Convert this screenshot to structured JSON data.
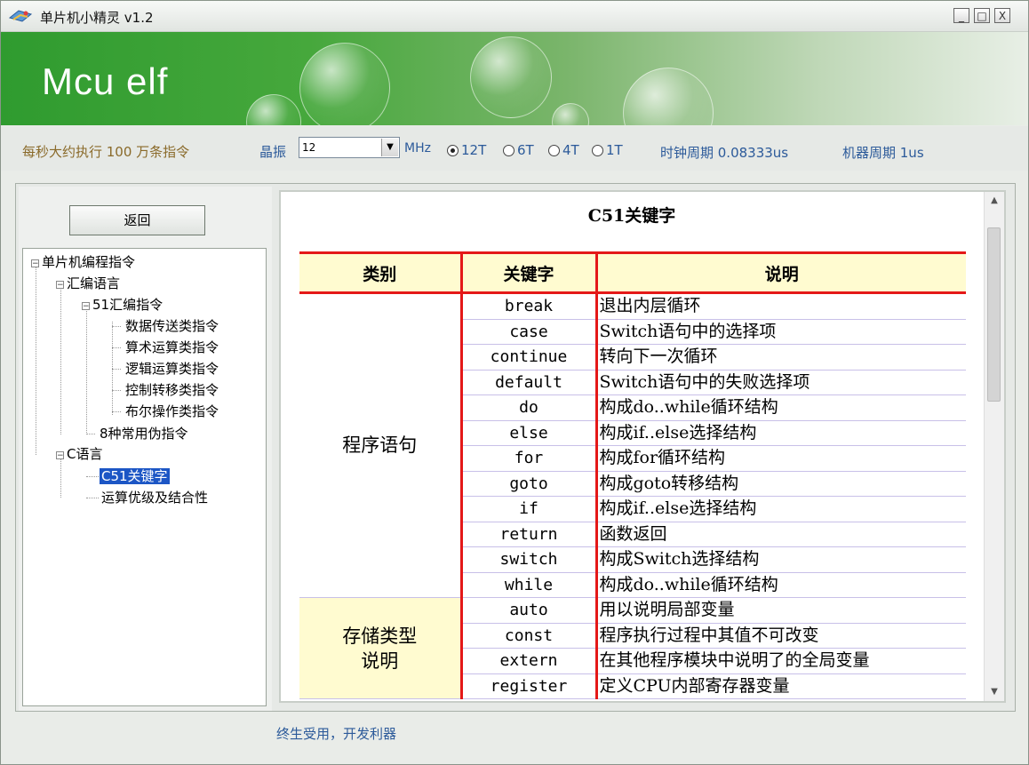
{
  "window": {
    "title": "单片机小精灵 v1.2",
    "controls": [
      "_",
      "□",
      "X"
    ]
  },
  "banner": {
    "logo": "Mcu elf"
  },
  "status": {
    "rate_text": "每秒大约执行 100 万条指令",
    "oscillator_label": "晶振",
    "oscillator_value": "12",
    "mhz_label": "MHz",
    "radios": [
      {
        "label": "12T",
        "selected": true
      },
      {
        "label": "6T",
        "selected": false
      },
      {
        "label": "4T",
        "selected": false
      },
      {
        "label": "1T",
        "selected": false
      }
    ],
    "clock_period": "时钟周期 0.08333us",
    "machine_period": "机器周期 1us"
  },
  "sidebar": {
    "back_label": "返回",
    "tree": {
      "root": "单片机编程指令",
      "asm": "汇编语言",
      "asm51": "51汇编指令",
      "asm51_items": [
        "数据传送类指令",
        "算术运算类指令",
        "逻辑运算类指令",
        "控制转移类指令",
        "布尔操作类指令"
      ],
      "pseudo": "8种常用伪指令",
      "clang": "C语言",
      "c51": "C51关键字",
      "priority": "运算优级及结合性"
    }
  },
  "content": {
    "title": "C51关键字",
    "headers": {
      "category": "类别",
      "keyword": "关键字",
      "description": "说明"
    },
    "groups": [
      {
        "category": "程序语句",
        "rows": [
          {
            "kw": "break",
            "desc": "退出内层循环"
          },
          {
            "kw": "case",
            "desc": "Switch语句中的选择项"
          },
          {
            "kw": "continue",
            "desc": "转向下一次循环"
          },
          {
            "kw": "default",
            "desc": "Switch语句中的失败选择项"
          },
          {
            "kw": "do",
            "desc": "构成do..while循环结构"
          },
          {
            "kw": "else",
            "desc": "构成if..else选择结构"
          },
          {
            "kw": "for",
            "desc": "构成for循环结构"
          },
          {
            "kw": "goto",
            "desc": "构成goto转移结构"
          },
          {
            "kw": "if",
            "desc": "构成if..else选择结构"
          },
          {
            "kw": "return",
            "desc": "函数返回"
          },
          {
            "kw": "switch",
            "desc": "构成Switch选择结构"
          },
          {
            "kw": "while",
            "desc": "构成do..while循环结构"
          }
        ]
      },
      {
        "category_line1": "存储类型",
        "category_line2": "说明",
        "rows": [
          {
            "kw": "auto",
            "desc": "用以说明局部变量"
          },
          {
            "kw": "const",
            "desc": "程序执行过程中其值不可改变"
          },
          {
            "kw": "extern",
            "desc": "在其他程序模块中说明了的全局变量"
          },
          {
            "kw": "register",
            "desc": "定义CPU内部寄存器变量"
          }
        ]
      }
    ]
  },
  "footer": {
    "text": "终生受用，开发利器"
  }
}
